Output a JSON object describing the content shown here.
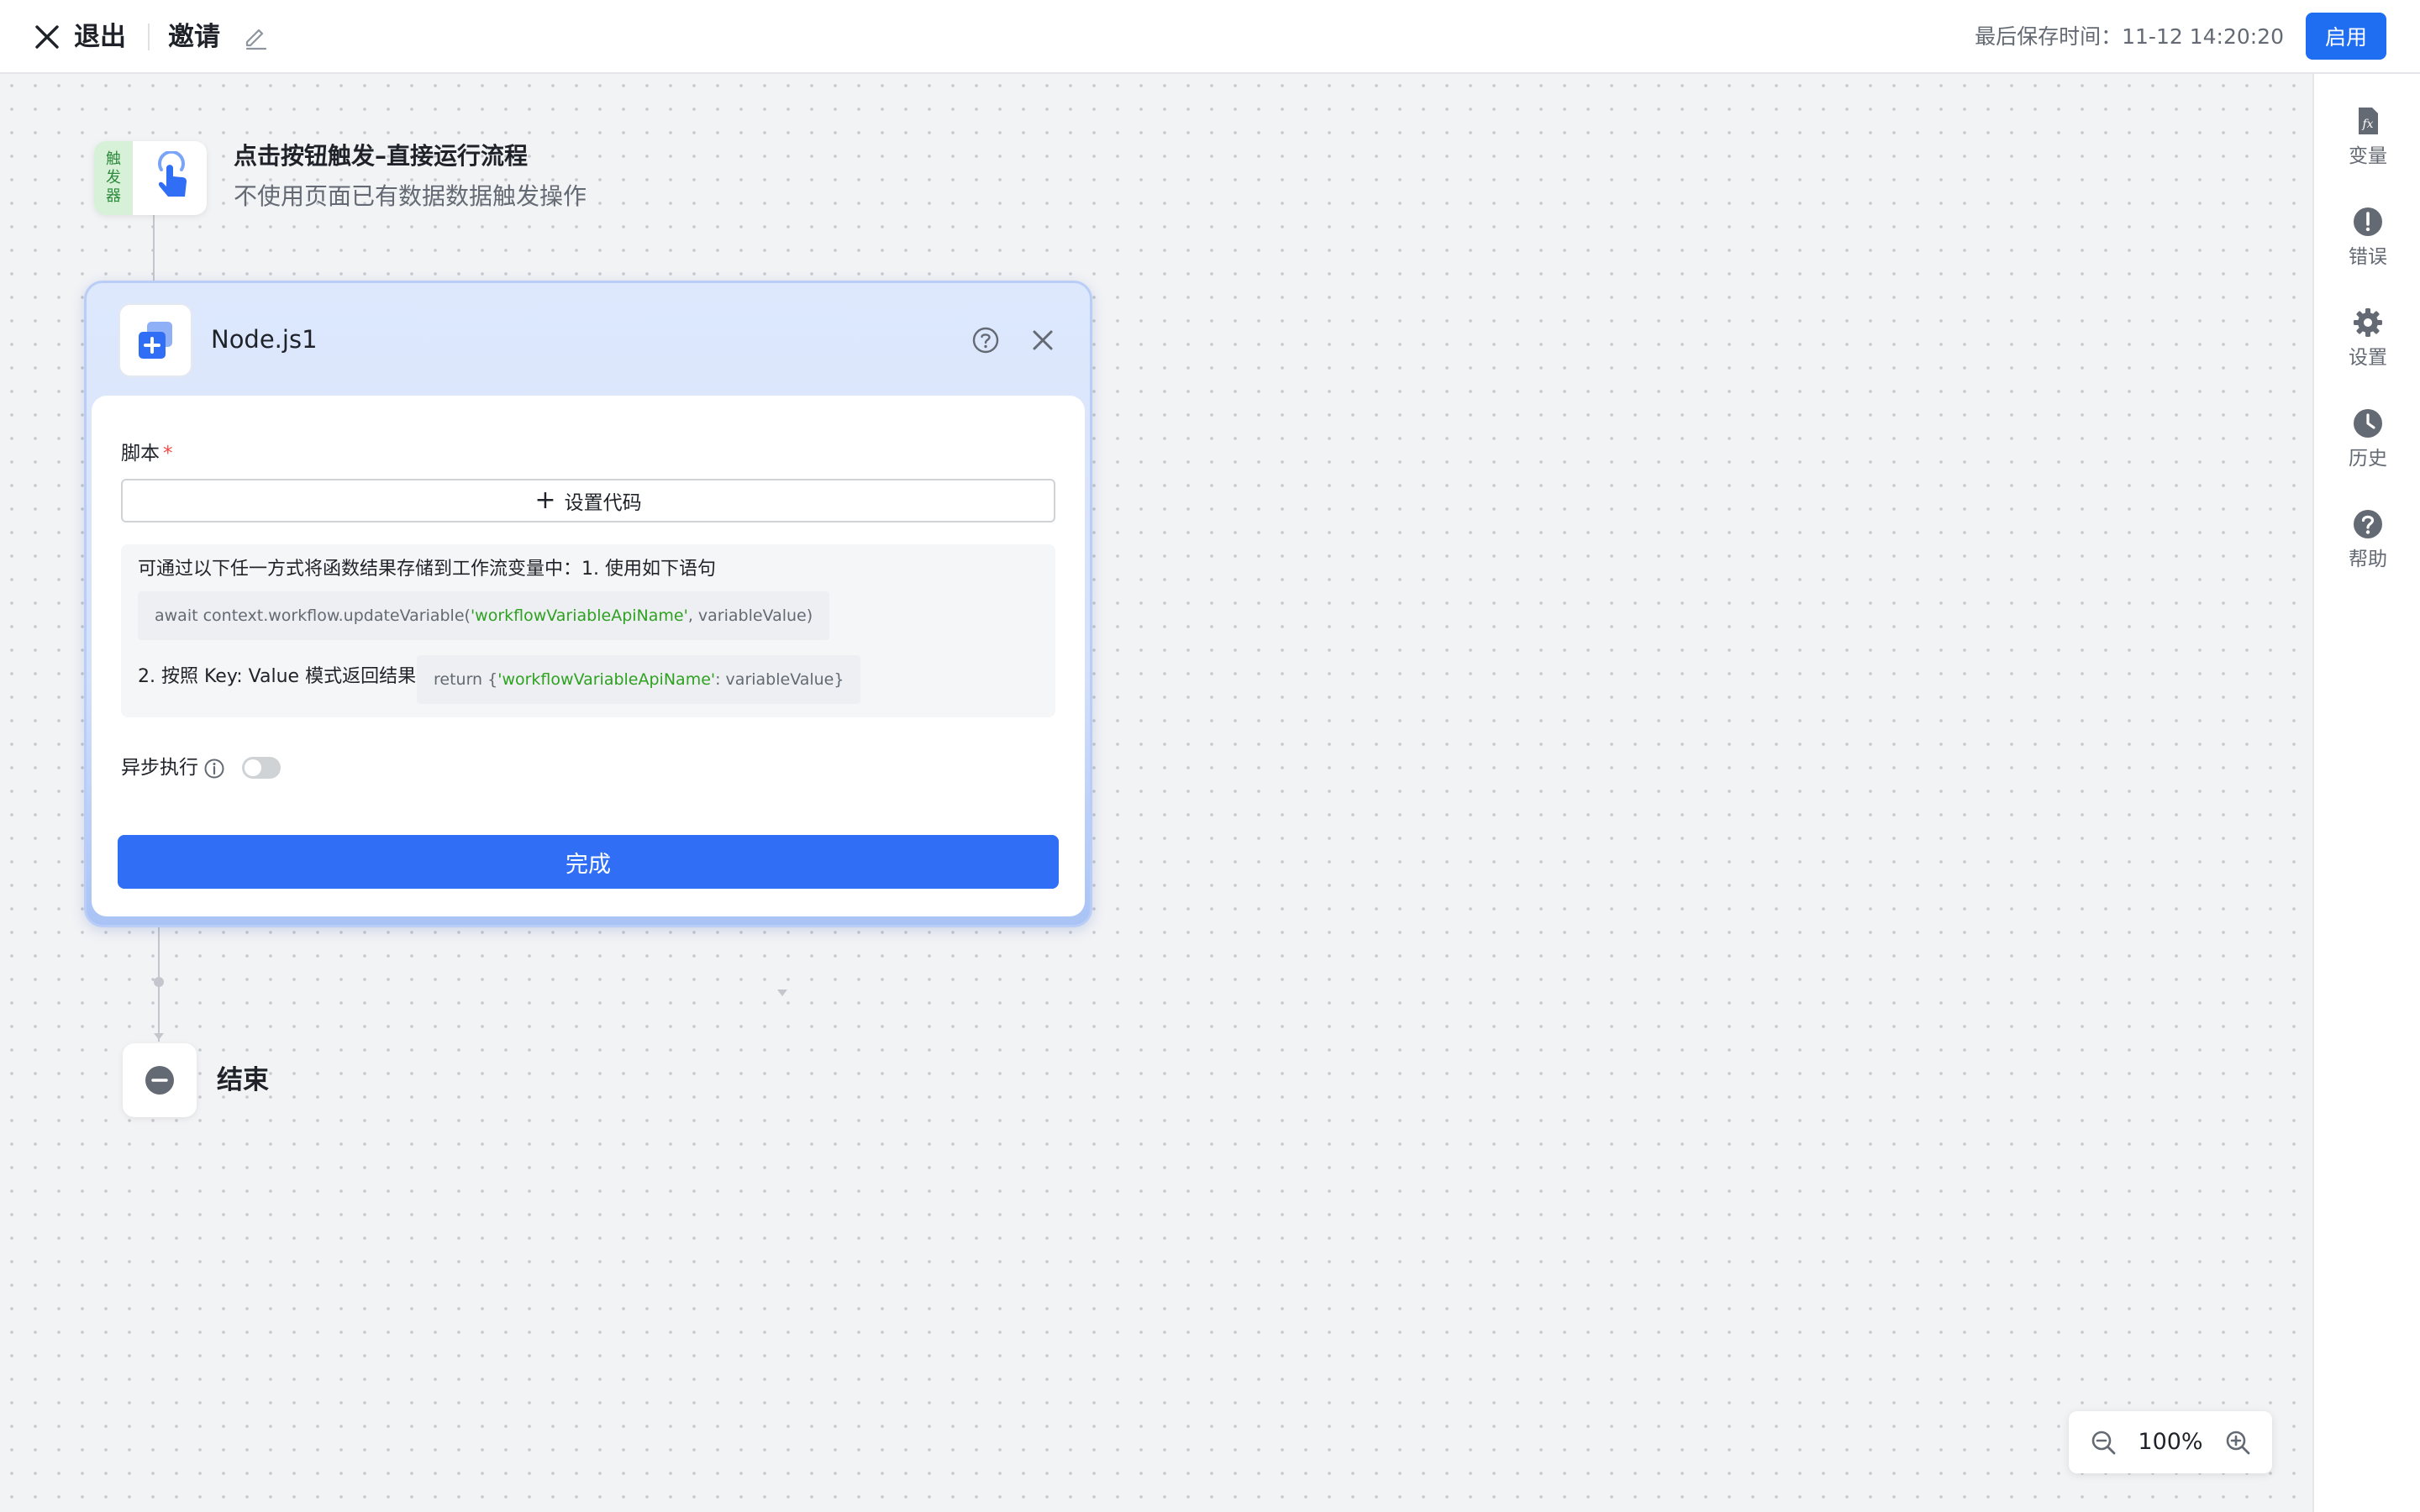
{
  "header": {
    "exit_label": "退出",
    "title": "邀请",
    "save_time": "最后保存时间：11-12 14:20:20",
    "enable_label": "启用"
  },
  "right_panel": {
    "items": [
      {
        "label": "变量",
        "icon": "fx-icon"
      },
      {
        "label": "错误",
        "icon": "error-icon"
      },
      {
        "label": "设置",
        "icon": "gear-icon"
      },
      {
        "label": "历史",
        "icon": "clock-icon"
      },
      {
        "label": "帮助",
        "icon": "help-icon"
      }
    ]
  },
  "trigger": {
    "tag": [
      "触",
      "发",
      "器"
    ],
    "title": "点击按钮触发–直接运行流程",
    "subtitle": "不使用页面已有数据数据触发操作"
  },
  "node": {
    "name": "Node.js1",
    "script_label": "脚本",
    "required_mark": "*",
    "set_code_label": "设置代码",
    "info_line1": "可通过以下任一方式将函数结果存储到工作流变量中：1. 使用如下语句",
    "code1_prefix": "await context.workflow.updateVariable(",
    "code1_highlight": "'workflowVariableApiName'",
    "code1_suffix": ", variableValue)",
    "info_line2": "2. 按照 Key: Value 模式返回结果",
    "code2_prefix": "return {",
    "code2_highlight": "'workflowVariableApiName'",
    "code2_suffix": ": variableValue}",
    "async_label": "异步执行",
    "async_enabled": false,
    "done_label": "完成"
  },
  "end_node": {
    "label": "结束"
  },
  "zoom": {
    "value": "100%"
  },
  "colors": {
    "primary": "#1f6ef2",
    "trigger_tag_bg": "#d7f1d9",
    "code_highlight": "#2ea121"
  }
}
